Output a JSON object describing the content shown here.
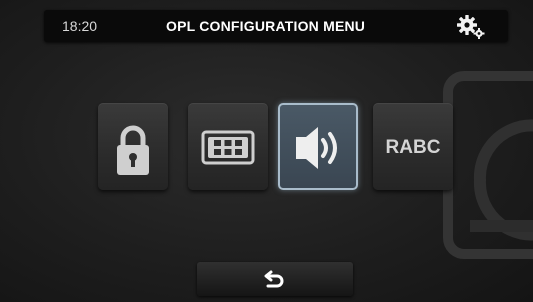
{
  "status_bar": {
    "time": "18:20",
    "title": "OPL CONFIGURATION MENU"
  },
  "menu": {
    "items": [
      {
        "name": "lock",
        "icon": "lock-icon"
      },
      {
        "name": "keypad",
        "icon": "keypad-icon"
      },
      {
        "name": "audio",
        "icon": "speaker-icon",
        "selected": true
      },
      {
        "name": "rabc",
        "label": "RABC"
      }
    ]
  },
  "footer": {
    "back_icon": "back-arrow-icon"
  },
  "colors": {
    "background": "#1e1e1e",
    "selected_border": "#a9bccb",
    "icon": "#d8d8d8"
  }
}
